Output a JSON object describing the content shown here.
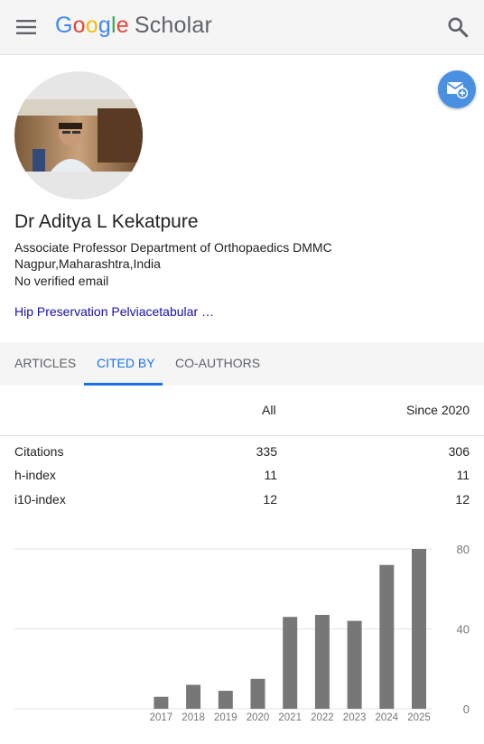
{
  "header": {
    "logo": {
      "google_letters": [
        "G",
        "o",
        "o",
        "g",
        "l",
        "e"
      ],
      "scholar": "Scholar"
    },
    "menu_icon": "hamburger-menu-icon",
    "search_icon": "search-icon"
  },
  "profile": {
    "name": "Dr Aditya L Kekatpure",
    "affiliation_line1": "Associate Professor Department of Orthopaedics DMMC",
    "affiliation_line2": "Nagpur,Maharashtra,India",
    "email": "No verified email",
    "interests": "Hip Preservation Pelviacetabular …",
    "follow_icon": "email-follow-icon"
  },
  "tabs": [
    {
      "label": "ARTICLES",
      "active": false
    },
    {
      "label": "CITED BY",
      "active": true
    },
    {
      "label": "CO-AUTHORS",
      "active": false
    }
  ],
  "stats": {
    "columns": [
      "All",
      "Since 2020"
    ],
    "rows": [
      {
        "label": "Citations",
        "all": "335",
        "since": "306"
      },
      {
        "label": "h-index",
        "all": "11",
        "since": "11"
      },
      {
        "label": "i10-index",
        "all": "12",
        "since": "12"
      }
    ]
  },
  "chart_data": {
    "type": "bar",
    "categories": [
      "2017",
      "2018",
      "2019",
      "2020",
      "2021",
      "2022",
      "2023",
      "2024",
      "2025"
    ],
    "values": [
      6,
      12,
      9,
      15,
      46,
      47,
      44,
      72,
      80
    ],
    "ylim": [
      0,
      80
    ],
    "yticks": [
      "80",
      "40",
      "0"
    ],
    "grid": true,
    "bar_color": "#777777"
  },
  "colors": {
    "accent": "#1a73e8",
    "link": "#1a0dab",
    "follow_button": "#4a90e2"
  }
}
